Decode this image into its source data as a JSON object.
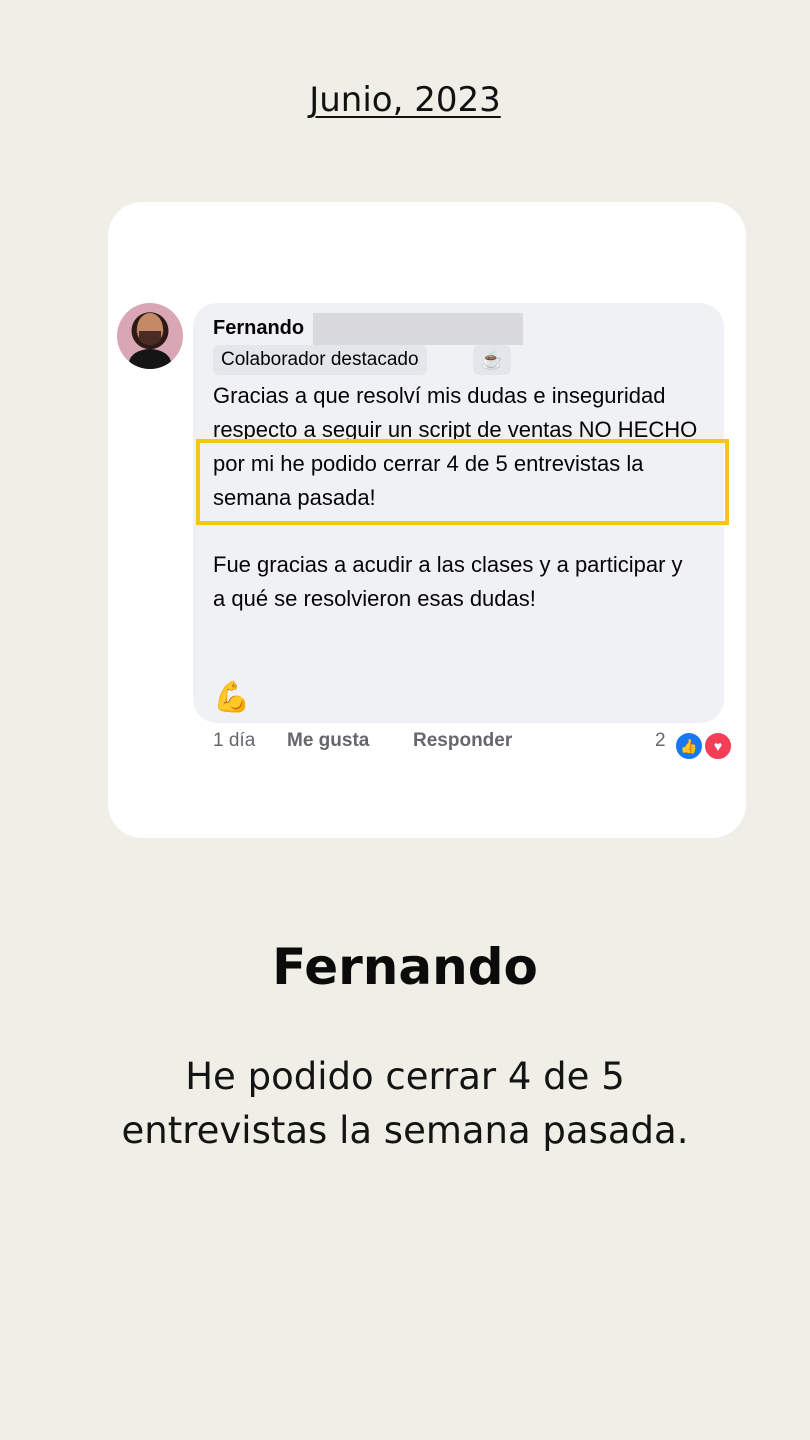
{
  "header": {
    "date": "Junio, 2023"
  },
  "comment": {
    "author": "Fernando",
    "badge": "Colaborador destacado",
    "badge_icon": "coffee-icon",
    "paragraph1": "Gracias a que resolví mis dudas e inseguridad respecto a seguir un script de ventas NO HECHO por mi he podido cerrar 4 de 5 entrevistas la semana pasada!",
    "paragraph2": "Fue gracias a acudir a las clases y a participar y a qué se resolvieron esas dudas!",
    "emoji": "💪",
    "time": "1 día",
    "like_label": "Me gusta",
    "reply_label": "Responder",
    "reaction_count": "2",
    "highlight_color": "#f5c518"
  },
  "testimonial": {
    "name": "Fernando",
    "quote": "He podido cerrar 4 de 5 entrevistas la semana pasada."
  },
  "colors": {
    "background": "#f0efe7",
    "card": "#ffffff",
    "bubble": "#f0f1f4",
    "like_blue": "#1877f2",
    "love_red": "#f33e58"
  }
}
